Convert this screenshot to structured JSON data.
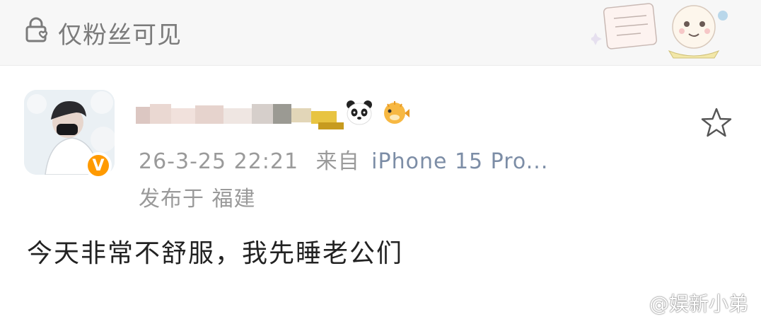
{
  "header": {
    "visibility_text": "仅粉丝可见",
    "lock_icon": "lock-heart-icon"
  },
  "post": {
    "author": {
      "verified_badge": "V"
    },
    "timestamp": "26-3-25 22:21",
    "source_prefix": "来自",
    "device": "iPhone 15 Pro...",
    "location": "发布于 福建",
    "content": "今天非常不舒服，我先睡老公们",
    "icons": [
      "panda-emoji-icon",
      "pufferfish-emoji-icon",
      "star-icon"
    ]
  },
  "watermark": {
    "text": "@娱新小弟"
  }
}
